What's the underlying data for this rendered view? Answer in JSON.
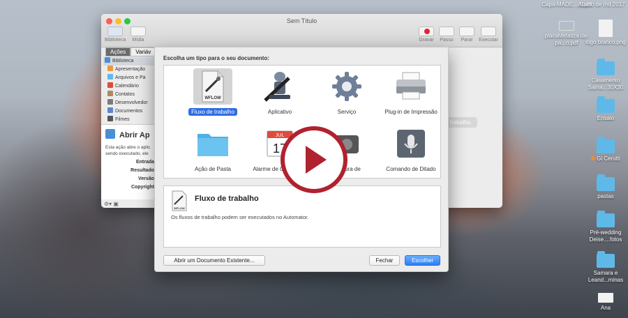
{
  "desktop": {
    "items": [
      {
        "label": "Capa-MADE....1.pdf",
        "kind": "doc"
      },
      {
        "label": "Atalho de Ind 2017",
        "kind": "doc"
      },
      {
        "label": "placaMetaliza da-pa...o.pdf",
        "kind": "doc"
      },
      {
        "label": "logo branco.png",
        "kind": "doc"
      },
      {
        "label": "Casamento Sama...30X30",
        "kind": "folder"
      },
      {
        "label": "Ensaio",
        "kind": "folder"
      },
      {
        "label": "Gi Cerutti",
        "kind": "folder"
      },
      {
        "label": "pastas",
        "kind": "folder"
      },
      {
        "label": "Pré-wedding Deise....fotos",
        "kind": "folder"
      },
      {
        "label": "Samara e Leand...minas",
        "kind": "folder"
      },
      {
        "label": "Ana",
        "kind": "doc"
      }
    ]
  },
  "window": {
    "title": "Sem Título",
    "toolbar_left": [
      "Biblioteca",
      "Mídia"
    ],
    "toolbar_right": [
      "Gravar",
      "Passo",
      "Parar",
      "Executar"
    ],
    "tabs": [
      "Ações",
      "Variáv"
    ],
    "library": [
      {
        "label": "Biblioteca",
        "color": "#4a8fd6"
      },
      {
        "label": "Apresentação",
        "color": "#e89a3c"
      },
      {
        "label": "Arquivos e Pa",
        "color": "#5fb9e8"
      },
      {
        "label": "Calendário",
        "color": "#e04a3a"
      },
      {
        "label": "Contatos",
        "color": "#b08a5a"
      },
      {
        "label": "Desenvolvedor",
        "color": "#7a7a7a"
      },
      {
        "label": "Documentos",
        "color": "#5a88c8"
      },
      {
        "label": "Filmes",
        "color": "#555555"
      }
    ],
    "detail": {
      "title": "Abrir Ap",
      "desc": "Esta ação abre o aplic sendo executado, ele",
      "meta": [
        "Entrada",
        "Resultado",
        "Versão",
        "Copyright"
      ]
    },
    "bubble": "trabalho."
  },
  "sheet": {
    "heading": "Escolha um tipo para o seu documento:",
    "types": [
      {
        "label": "Fluxo de trabalho",
        "icon": "workflow-icon",
        "selected": true
      },
      {
        "label": "Aplicativo",
        "icon": "robot-icon",
        "selected": false
      },
      {
        "label": "Serviço",
        "icon": "gear-icon",
        "selected": false
      },
      {
        "label": "Plug-in de Impressão",
        "icon": "printer-icon",
        "selected": false
      },
      {
        "label": "Ação de Pasta",
        "icon": "folder-icon",
        "selected": false
      },
      {
        "label": "Alarme de Calendário",
        "icon": "calendar-icon",
        "selected": false
      },
      {
        "label": "Captura de",
        "icon": "camera-icon",
        "selected": false
      },
      {
        "label": "Comando de Ditado",
        "icon": "microphone-icon",
        "selected": false
      }
    ],
    "calendar": {
      "month": "JUL",
      "day": "17"
    },
    "workflow_badge": "WFLOW",
    "description": {
      "title": "Fluxo de trabalho",
      "text": "Os fluxos de trabalho podem ser executados no Automator."
    },
    "buttons": {
      "open_existing": "Abrir um Documento Existente...",
      "close": "Fechar",
      "choose": "Escolher"
    }
  },
  "colors": {
    "play": "#b02230",
    "accent": "#2f6de2"
  }
}
